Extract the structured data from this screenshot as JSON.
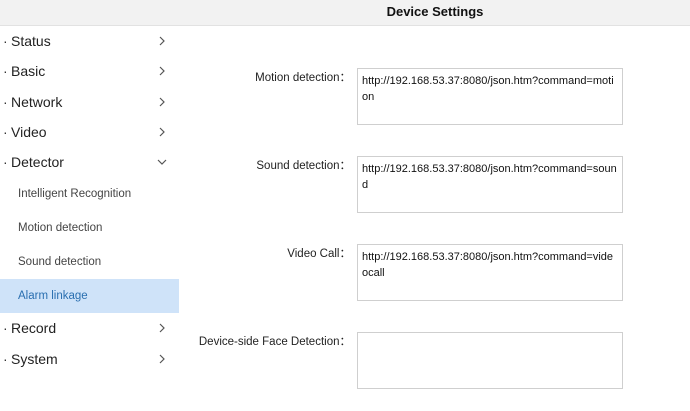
{
  "header": {
    "title": "Device Settings"
  },
  "sidebar": {
    "bullet": "·",
    "menu": [
      {
        "label": "Status"
      },
      {
        "label": "Basic"
      },
      {
        "label": "Network"
      },
      {
        "label": "Video"
      },
      {
        "label": "Detector"
      },
      {
        "label": "Record"
      },
      {
        "label": "System"
      }
    ],
    "detector_sub": [
      {
        "label": "Intelligent Recognition"
      },
      {
        "label": "Motion detection"
      },
      {
        "label": "Sound detection"
      },
      {
        "label": "Alarm linkage"
      }
    ]
  },
  "fields": [
    {
      "label": "Motion detection：",
      "value": "http://192.168.53.37:8080/json.htm?command=motion"
    },
    {
      "label": "Sound detection：",
      "value": "http://192.168.53.37:8080/json.htm?command=sound"
    },
    {
      "label": "Video Call：",
      "value": "http://192.168.53.37:8080/json.htm?command=videocall"
    },
    {
      "label": "Device-side Face Detection：",
      "value": ""
    }
  ],
  "colors": {
    "active_bg": "#cfe3f9",
    "active_text": "#2a6fb0",
    "header_bg": "#f2f2f2"
  }
}
